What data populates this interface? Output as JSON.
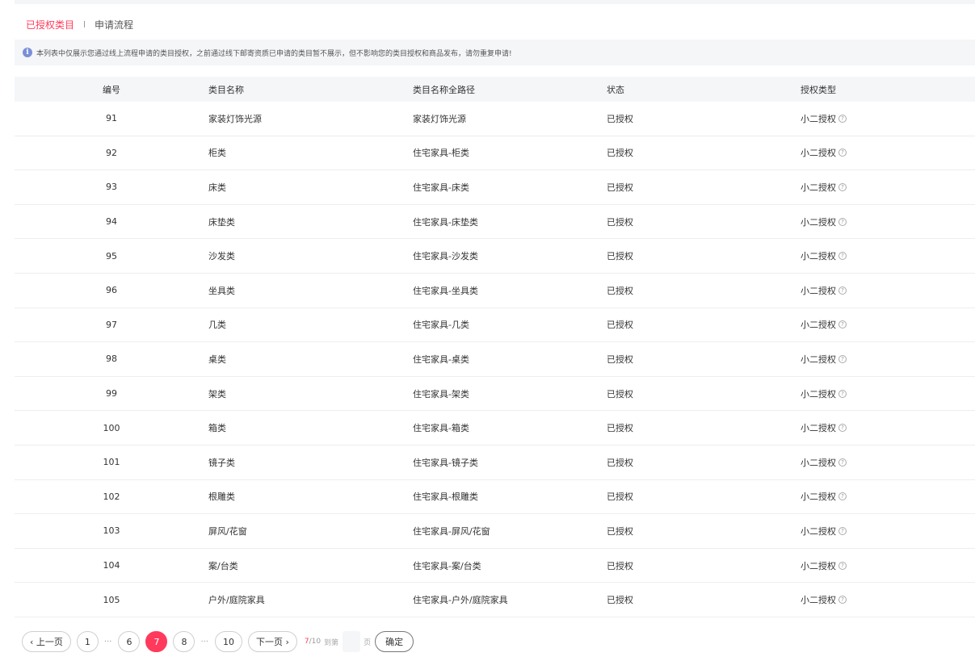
{
  "tabs": {
    "active": "已授权类目",
    "inactive": "申请流程"
  },
  "notice": {
    "text": "本列表中仅展示您通过线上流程申请的类目授权，之前通过线下邮寄资质已申请的类目暂不展示，但不影响您的类目授权和商品发布，请勿重复申请!"
  },
  "table": {
    "headers": {
      "id": "编号",
      "name": "类目名称",
      "path": "类目名称全路径",
      "status": "状态",
      "type": "授权类型"
    },
    "rows": [
      {
        "id": "91",
        "name": "家装灯饰光源",
        "path": "家装灯饰光源",
        "status": "已授权",
        "type": "小二授权"
      },
      {
        "id": "92",
        "name": "柜类",
        "path": "住宅家具-柜类",
        "status": "已授权",
        "type": "小二授权"
      },
      {
        "id": "93",
        "name": "床类",
        "path": "住宅家具-床类",
        "status": "已授权",
        "type": "小二授权"
      },
      {
        "id": "94",
        "name": "床垫类",
        "path": "住宅家具-床垫类",
        "status": "已授权",
        "type": "小二授权"
      },
      {
        "id": "95",
        "name": "沙发类",
        "path": "住宅家具-沙发类",
        "status": "已授权",
        "type": "小二授权"
      },
      {
        "id": "96",
        "name": "坐具类",
        "path": "住宅家具-坐具类",
        "status": "已授权",
        "type": "小二授权"
      },
      {
        "id": "97",
        "name": "几类",
        "path": "住宅家具-几类",
        "status": "已授权",
        "type": "小二授权"
      },
      {
        "id": "98",
        "name": "桌类",
        "path": "住宅家具-桌类",
        "status": "已授权",
        "type": "小二授权"
      },
      {
        "id": "99",
        "name": "架类",
        "path": "住宅家具-架类",
        "status": "已授权",
        "type": "小二授权"
      },
      {
        "id": "100",
        "name": "箱类",
        "path": "住宅家具-箱类",
        "status": "已授权",
        "type": "小二授权"
      },
      {
        "id": "101",
        "name": "镜子类",
        "path": "住宅家具-镜子类",
        "status": "已授权",
        "type": "小二授权"
      },
      {
        "id": "102",
        "name": "根雕类",
        "path": "住宅家具-根雕类",
        "status": "已授权",
        "type": "小二授权"
      },
      {
        "id": "103",
        "name": "屏风/花窗",
        "path": "住宅家具-屏风/花窗",
        "status": "已授权",
        "type": "小二授权"
      },
      {
        "id": "104",
        "name": "案/台类",
        "path": "住宅家具-案/台类",
        "status": "已授权",
        "type": "小二授权"
      },
      {
        "id": "105",
        "name": "户外/庭院家具",
        "path": "住宅家具-户外/庭院家具",
        "status": "已授权",
        "type": "小二授权"
      }
    ]
  },
  "pagination": {
    "prev": "‹ 上一页",
    "next": "下一页 ›",
    "pages": [
      "1",
      "6",
      "7",
      "8",
      "10"
    ],
    "current": "7",
    "current_label": "7",
    "total_label": "/10",
    "goto_label": "到第",
    "page_unit": "页",
    "confirm": "确定",
    "ellipsis": "···"
  }
}
